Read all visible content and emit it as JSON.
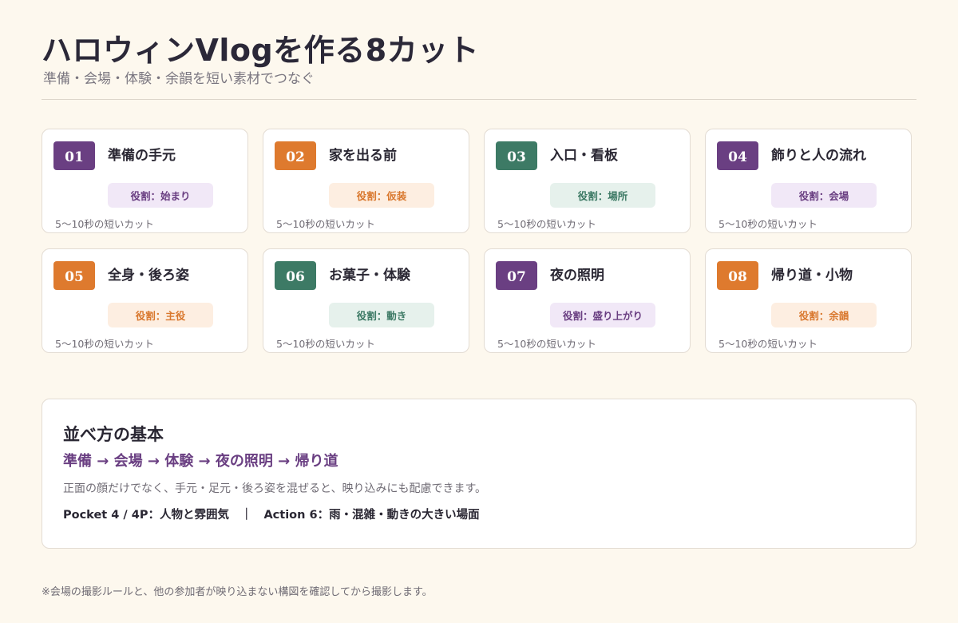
{
  "header": {
    "title": "ハロウィンVlogを作る8カット",
    "subtitle": "準備・会場・体験・余韻を短い素材でつなぐ"
  },
  "colors": {
    "purple": "#6a3f82",
    "orange": "#de7a2e",
    "green": "#3d7a65",
    "background": "#fdf8ee"
  },
  "cuts": [
    {
      "number": "01",
      "title": "準備の手元",
      "role": "役割：始まり",
      "note": "5〜10秒の短いカット",
      "color": "purple"
    },
    {
      "number": "02",
      "title": "家を出る前",
      "role": "役割：仮装",
      "note": "5〜10秒の短いカット",
      "color": "orange"
    },
    {
      "number": "03",
      "title": "入口・看板",
      "role": "役割：場所",
      "note": "5〜10秒の短いカット",
      "color": "green"
    },
    {
      "number": "04",
      "title": "飾りと人の流れ",
      "role": "役割：会場",
      "note": "5〜10秒の短いカット",
      "color": "purple"
    },
    {
      "number": "05",
      "title": "全身・後ろ姿",
      "role": "役割：主役",
      "note": "5〜10秒の短いカット",
      "color": "orange"
    },
    {
      "number": "06",
      "title": "お菓子・体験",
      "role": "役割：動き",
      "note": "5〜10秒の短いカット",
      "color": "green"
    },
    {
      "number": "07",
      "title": "夜の照明",
      "role": "役割：盛り上がり",
      "note": "5〜10秒の短いカット",
      "color": "purple"
    },
    {
      "number": "08",
      "title": "帰り道・小物",
      "role": "役割：余韻",
      "note": "5〜10秒の短いカット",
      "color": "orange"
    }
  ],
  "panel": {
    "title": "並べ方の基本",
    "flow": "準備 → 会場 → 体験 → 夜の照明 → 帰り道",
    "description": "正面の顔だけでなく、手元・足元・後ろ姿を混ぜると、映り込みにも配慮できます。",
    "models": "Pocket 4 / 4P：人物と雰囲気　｜　Action 6：雨・混雑・動きの大きい場面"
  },
  "footnote": "※会場の撮影ルールと、他の参加者が映り込まない構図を確認してから撮影します。"
}
